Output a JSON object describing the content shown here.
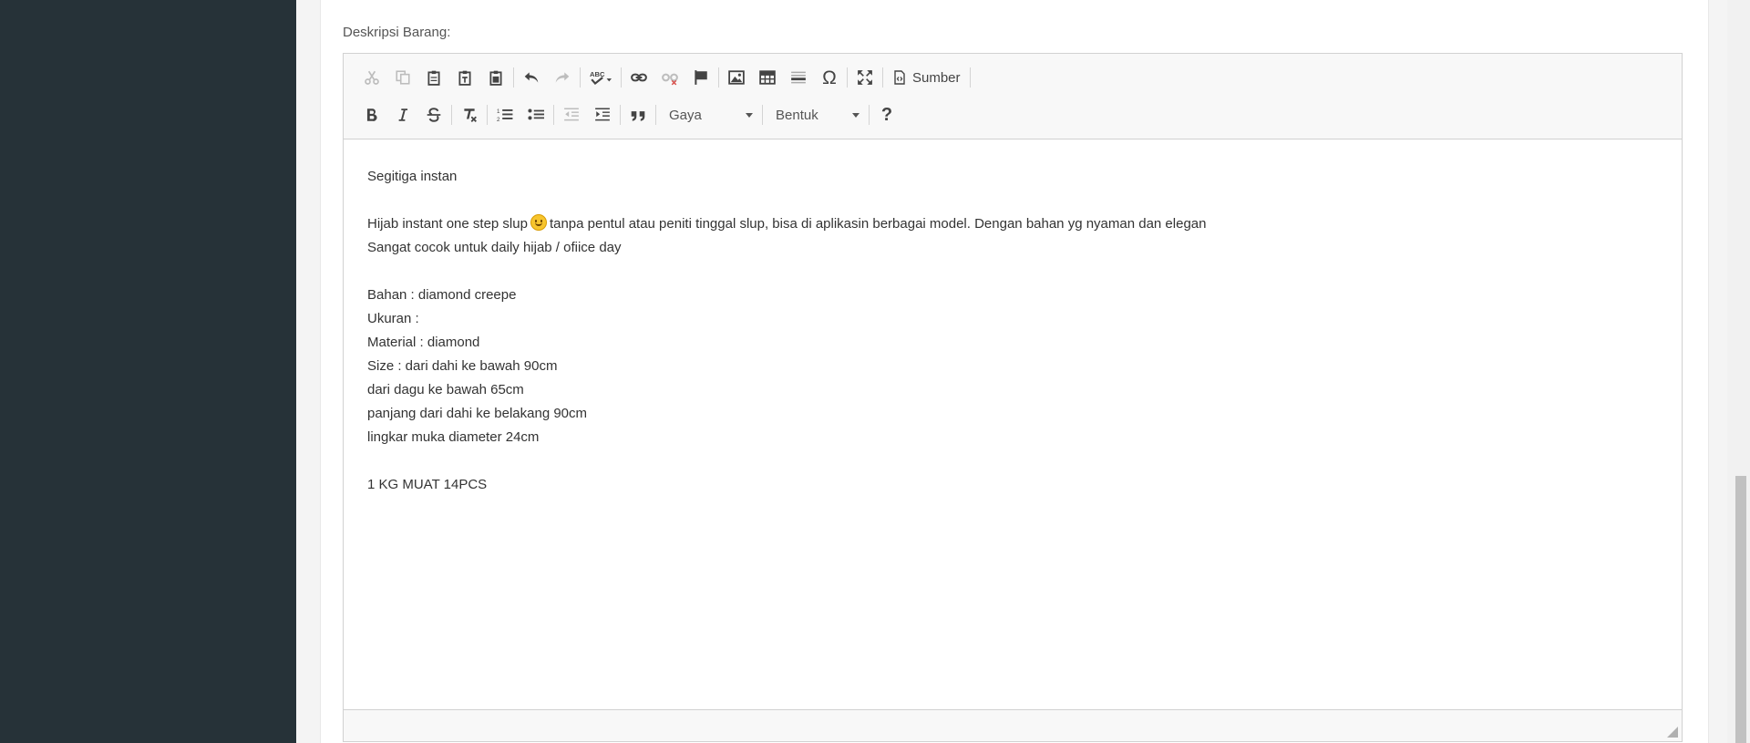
{
  "form": {
    "description_label": "Deskripsi Barang:"
  },
  "editor": {
    "toolbar": {
      "source_label": "Sumber",
      "style_combo": "Gaya",
      "format_combo": "Bentuk",
      "help_label": "?",
      "special_char": "Ω"
    },
    "content": {
      "lines": [
        "Segitiga instan",
        "",
        "Hijab instant one step slup",
        "tanpa pentul atau peniti tinggal slup, bisa di aplikasin berbagai model. Dengan bahan yg nyaman dan elegan",
        "Sangat cocok untuk daily hijab / ofiice day",
        "",
        "Bahan : diamond creepe",
        "Ukuran :",
        "Material : diamond",
        "Size : dari dahi ke bawah 90cm",
        "dari dagu ke bawah 65cm",
        "panjang dari dahi ke belakang 90cm",
        "lingkar muka diameter 24cm",
        "",
        "1 KG MUAT 14PCS"
      ]
    }
  },
  "colors": {
    "sidebar": "#263238",
    "toolbar_bg": "#f8f8f8",
    "editor_border": "#d1d1d1"
  }
}
